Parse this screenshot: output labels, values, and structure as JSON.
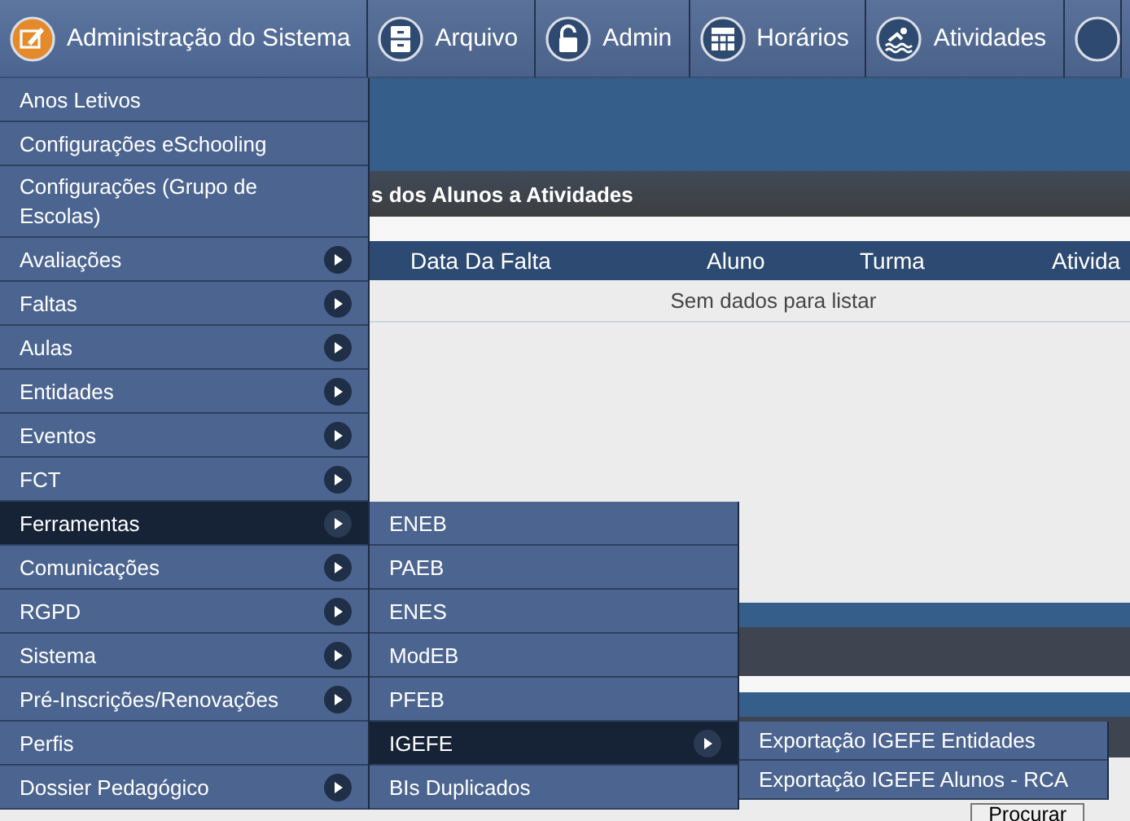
{
  "navbar": {
    "items": [
      {
        "label": "Administração do Sistema",
        "kind": "edit",
        "selected": true
      },
      {
        "label": "Arquivo",
        "kind": "cabinet",
        "selected": false
      },
      {
        "label": "Admin",
        "kind": "lock",
        "selected": false
      },
      {
        "label": "Horários",
        "kind": "grid",
        "selected": false
      },
      {
        "label": "Atividades",
        "kind": "swim",
        "selected": false
      }
    ]
  },
  "section_title": "s dos Alunos a Atividades",
  "table": {
    "columns": [
      "Data Da Falta",
      "Aluno",
      "Turma",
      "Ativida"
    ],
    "empty_message": "Sem dados para listar"
  },
  "search_button": "Procurar",
  "menu": {
    "items": [
      {
        "label": "Anos Letivos",
        "has_submenu": false,
        "selected": false
      },
      {
        "label": "Configurações eSchooling",
        "has_submenu": false,
        "selected": false
      },
      {
        "label": "Configurações (Grupo de Escolas)",
        "has_submenu": false,
        "selected": false
      },
      {
        "label": "Avaliações",
        "has_submenu": true,
        "selected": false
      },
      {
        "label": "Faltas",
        "has_submenu": true,
        "selected": false
      },
      {
        "label": "Aulas",
        "has_submenu": true,
        "selected": false
      },
      {
        "label": "Entidades",
        "has_submenu": true,
        "selected": false
      },
      {
        "label": "Eventos",
        "has_submenu": true,
        "selected": false
      },
      {
        "label": "FCT",
        "has_submenu": true,
        "selected": false
      },
      {
        "label": "Ferramentas",
        "has_submenu": true,
        "selected": true,
        "children": [
          {
            "label": "ENEB",
            "has_submenu": false,
            "selected": false
          },
          {
            "label": "PAEB",
            "has_submenu": false,
            "selected": false
          },
          {
            "label": "ENES",
            "has_submenu": false,
            "selected": false
          },
          {
            "label": "ModEB",
            "has_submenu": false,
            "selected": false
          },
          {
            "label": "PFEB",
            "has_submenu": false,
            "selected": false
          },
          {
            "label": "IGEFE",
            "has_submenu": true,
            "selected": true,
            "children": [
              {
                "label": "Exportação IGEFE Entidades",
                "has_submenu": false,
                "selected": false
              },
              {
                "label": "Exportação IGEFE Alunos - RCA",
                "has_submenu": false,
                "selected": false
              }
            ]
          },
          {
            "label": "BIs Duplicados",
            "has_submenu": false,
            "selected": false
          }
        ]
      },
      {
        "label": "Comunicações",
        "has_submenu": true,
        "selected": false
      },
      {
        "label": "RGPD",
        "has_submenu": true,
        "selected": false
      },
      {
        "label": "Sistema",
        "has_submenu": true,
        "selected": false
      },
      {
        "label": "Pré-Inscrições/Renovações",
        "has_submenu": true,
        "selected": false
      },
      {
        "label": "Perfis",
        "has_submenu": false,
        "selected": false
      },
      {
        "label": "Dossier Pedagógico",
        "has_submenu": true,
        "selected": false
      }
    ]
  }
}
